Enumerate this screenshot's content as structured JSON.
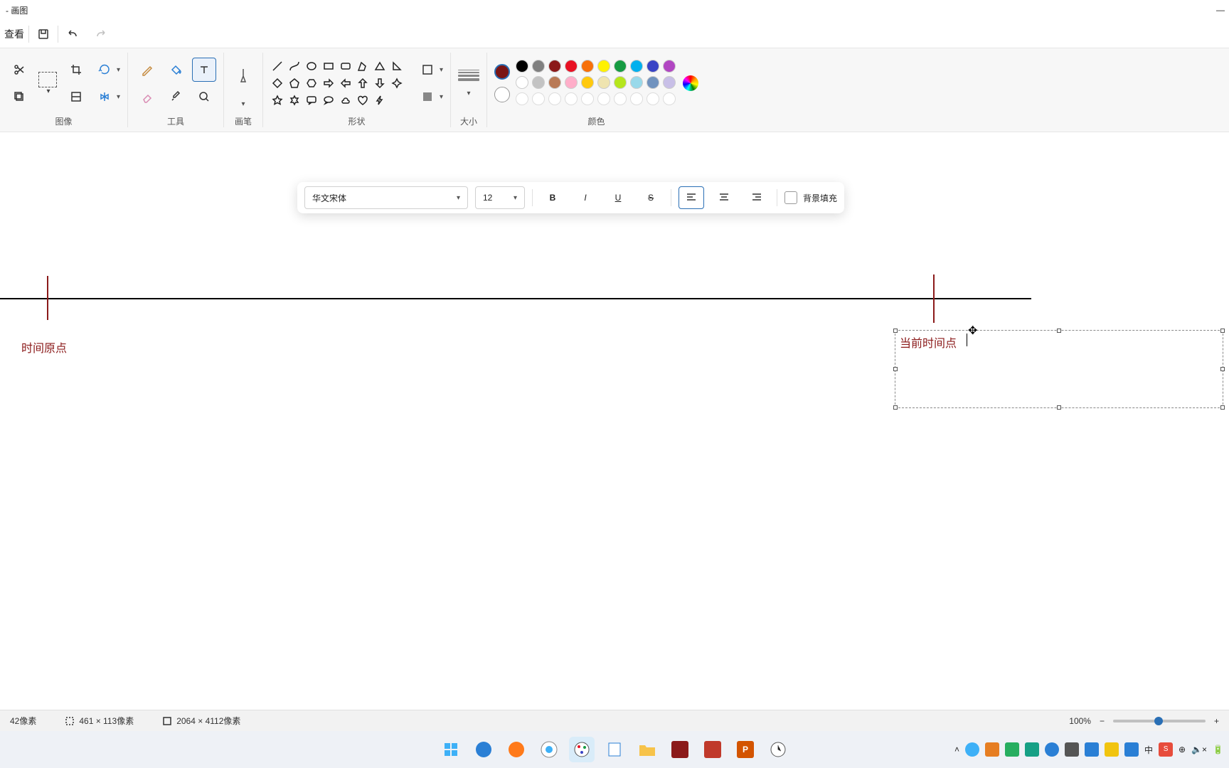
{
  "title": "- 画图",
  "quick": {
    "view_label": "查看"
  },
  "ribbon": {
    "image": "图像",
    "tools": "工具",
    "brushes": "画笔",
    "shapes": "形状",
    "size": "大小",
    "colors": "颜色"
  },
  "colors": {
    "active": "#7a1515",
    "secondary": "#ffffff",
    "row1": [
      "#000000",
      "#808080",
      "#8b1a1a",
      "#e81123",
      "#f7700a",
      "#fff100",
      "#169b42",
      "#00b0ee",
      "#3943c5",
      "#b146c2"
    ],
    "row2": [
      "#ffffff",
      "#c3c3c3",
      "#b97a56",
      "#ffaec9",
      "#ffc90e",
      "#efe4b0",
      "#b5e61d",
      "#99d9ea",
      "#7092be",
      "#c8bfe7"
    ],
    "row3": [
      "#ffffff",
      "#ffffff",
      "#ffffff",
      "#ffffff",
      "#ffffff",
      "#ffffff",
      "#ffffff",
      "#ffffff",
      "#ffffff",
      "#ffffff"
    ]
  },
  "text_tb": {
    "font": "华文宋体",
    "size": "12",
    "bg_fill": "背景填充"
  },
  "canvas": {
    "label_origin": "时间原点",
    "label_current": "当前时间点"
  },
  "status": {
    "pos": "42像素",
    "sel": "461 × 113像素",
    "img": "2064 × 4112像素",
    "zoom": "100%"
  }
}
